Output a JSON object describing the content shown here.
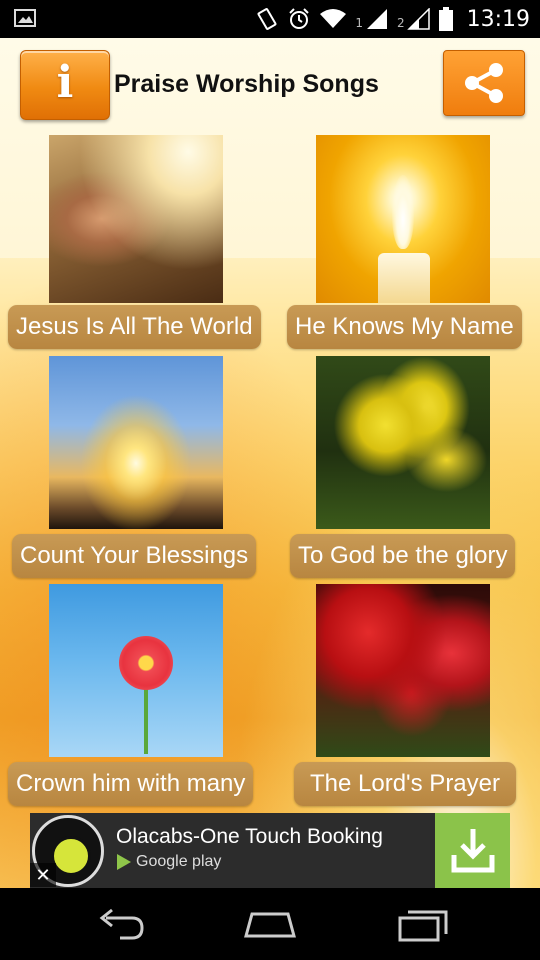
{
  "status_bar": {
    "time": "13:19",
    "sim1_label": "1",
    "sim2_label": "2"
  },
  "header": {
    "title": "Praise Worship Songs",
    "info_glyph": "i"
  },
  "songs": [
    {
      "label": "Jesus Is All The World"
    },
    {
      "label": "He Knows My Name"
    },
    {
      "label": "Count Your Blessings"
    },
    {
      "label": "To God be the glory"
    },
    {
      "label": "Crown him with many"
    },
    {
      "label": "The Lord's Prayer"
    }
  ],
  "ad": {
    "title": "Olacabs-One Touch Booking",
    "store_label": "Google play",
    "close_glyph": "✕",
    "accent": "#8bc34a"
  },
  "colors": {
    "caption_bg": "#c09048",
    "button_orange": "#f08a12"
  }
}
